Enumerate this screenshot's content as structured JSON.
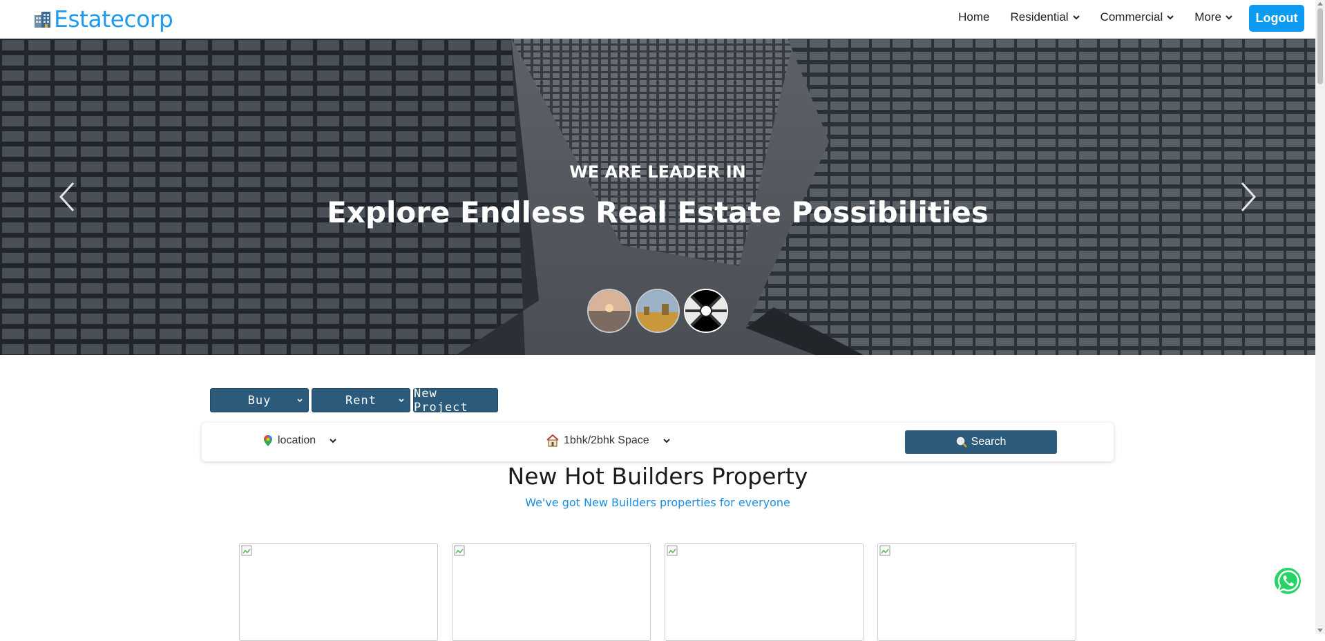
{
  "navbar": {
    "brand": "Estatecorp",
    "links": [
      {
        "label": "Home",
        "dropdown": false
      },
      {
        "label": "Residential",
        "dropdown": true
      },
      {
        "label": "Commercial",
        "dropdown": true
      },
      {
        "label": "More",
        "dropdown": true
      }
    ],
    "logout_label": "Logout"
  },
  "hero": {
    "eyebrow": "WE ARE LEADER IN",
    "title": "Explore Endless Real Estate Possibilities",
    "thumbnails": [
      "city-sunset",
      "city-golden",
      "architecture-bw"
    ],
    "active_thumbnail": 2
  },
  "search": {
    "tabs": [
      {
        "label": "Buy",
        "dropdown": true
      },
      {
        "label": "Rent",
        "dropdown": true
      },
      {
        "label": "New Project",
        "dropdown": false
      }
    ],
    "location_value": "location",
    "type_value": "1bhk/2bhk Space",
    "search_label": "Search",
    "icons": {
      "location": "map-pin-icon",
      "type": "house-icon",
      "search": "magnifier-icon"
    }
  },
  "section": {
    "title": "New Hot Builders Property",
    "subtitle": "We've got New Builders properties for everyone"
  },
  "cards": [
    {
      "image": "broken-image-icon"
    },
    {
      "image": "broken-image-icon"
    },
    {
      "image": "broken-image-icon"
    },
    {
      "image": "broken-image-icon"
    }
  ],
  "colors": {
    "brand": "#1d9bf0",
    "primary_button": "#2b5a7a",
    "logout": "#0d9bf2",
    "whatsapp": "#25d366"
  }
}
